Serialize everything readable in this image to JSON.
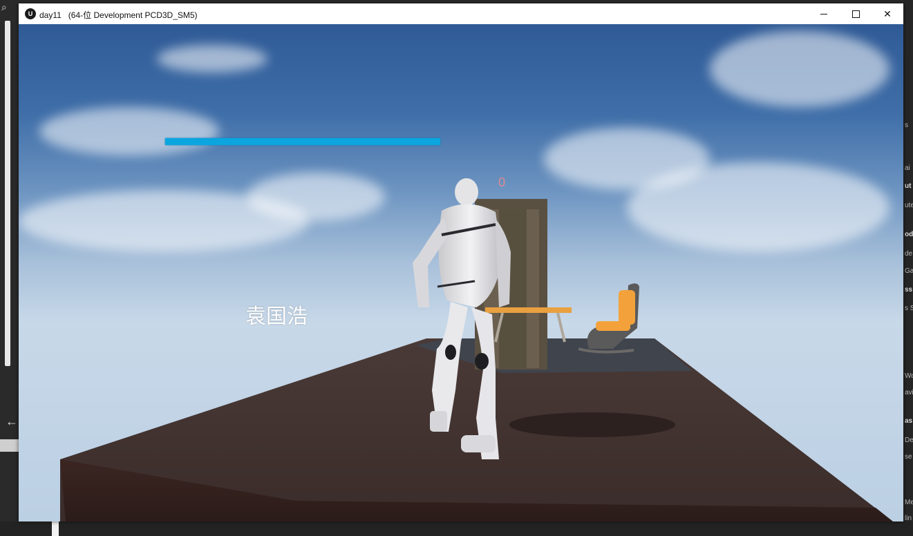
{
  "window": {
    "title": "day11   (64-位 Development PCD3D_SM5)",
    "logo": "ue-logo-icon",
    "controls": [
      "minimize-icon",
      "maximize-icon",
      "close-icon"
    ],
    "close_glyph": "✕"
  },
  "hud": {
    "health_fill": 1.0,
    "health_color": "#0ba5e0",
    "score": "0",
    "player_name": "袁国浩"
  },
  "editor_chrome": {
    "left_back_glyph": "←",
    "left_search_icon": "search-icon",
    "right_fragments": [
      "s",
      "ai",
      "ut",
      "ute",
      "od",
      "de",
      "Ga",
      "ss",
      "s S",
      "Wo",
      "avi",
      "as",
      "De",
      "se",
      "Me",
      "lin"
    ]
  }
}
